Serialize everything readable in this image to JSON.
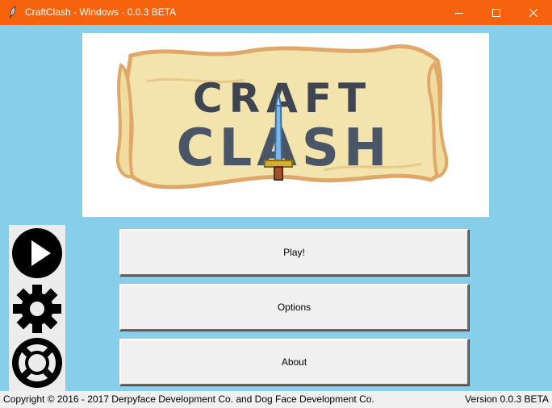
{
  "window": {
    "title": "CraftClash - Windows - 0.0.3 BETA",
    "titlebar_color": "#f7630c",
    "icon": "feather-icon"
  },
  "logo": {
    "line1": "CRAFT",
    "line2": "CLASH"
  },
  "side_icons": [
    "play-icon",
    "gear-icon",
    "ring-icon"
  ],
  "menu": {
    "play_label": "Play!",
    "options_label": "Options",
    "about_label": "About"
  },
  "footer": {
    "copyright": "Copyright © 2016 - 2017 Derpyface Development Co. and Dog Face Development Co.",
    "version": "Version 0.0.3 BETA"
  },
  "colors": {
    "background": "#87ceeb",
    "button_face": "#f0f0f0"
  }
}
